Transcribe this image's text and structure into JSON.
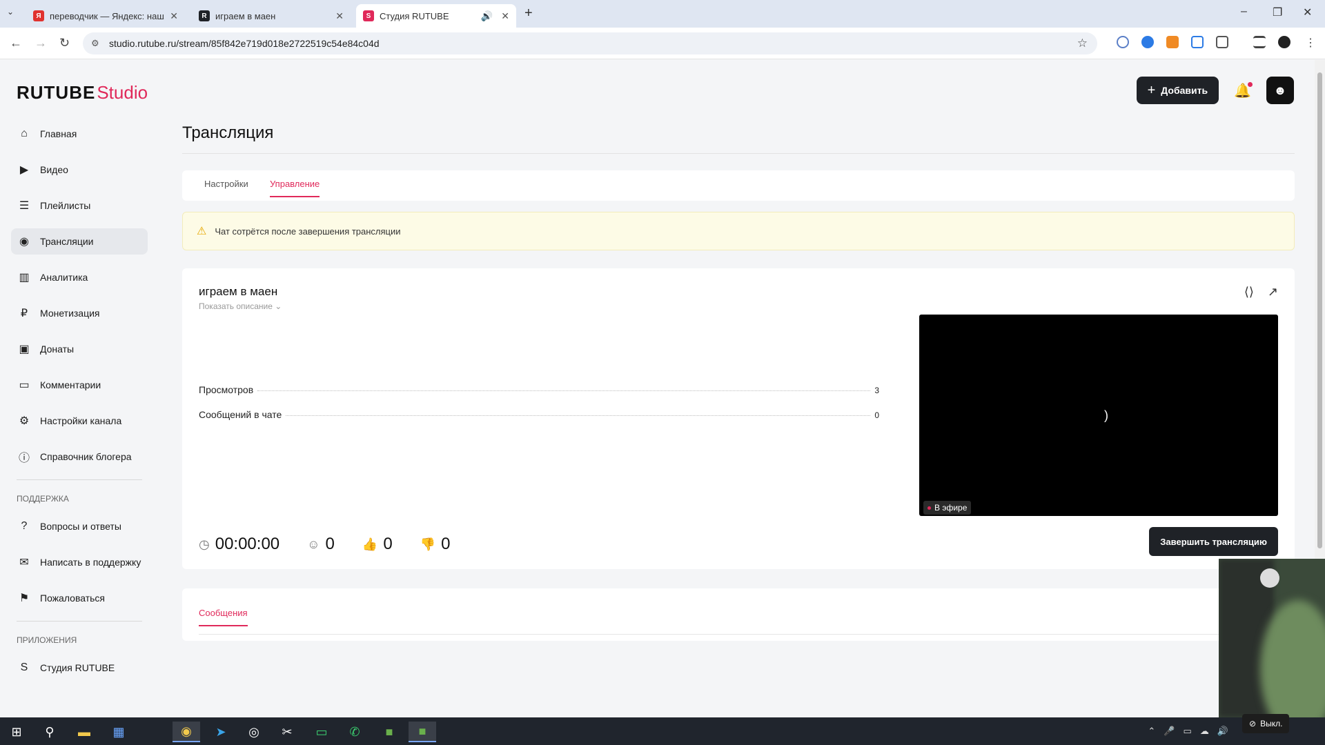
{
  "browser": {
    "tabs": [
      {
        "title": "переводчик — Яндекс: нашлось",
        "icon": "yandex-icon",
        "color": "#e0322f",
        "glyph": "Я"
      },
      {
        "title": "играем в маен",
        "icon": "rutube-icon",
        "color": "#1f2227",
        "glyph": "R"
      },
      {
        "title": "Студия RUTUBE",
        "icon": "rutube-studio-icon",
        "color": "#e0295a",
        "glyph": "S"
      }
    ],
    "url": "studio.rutube.ru/stream/85f842e719d018e2722519c54e84c04d"
  },
  "header": {
    "logo_main": "RUTUBE",
    "logo_sub": "Studio",
    "add_label": "Добавить"
  },
  "sidebar": {
    "items": [
      {
        "label": "Главная",
        "icon": "home-icon",
        "glyph": "⌂"
      },
      {
        "label": "Видео",
        "icon": "video-icon",
        "glyph": "▶"
      },
      {
        "label": "Плейлисты",
        "icon": "playlist-icon",
        "glyph": "☰"
      },
      {
        "label": "Трансляции",
        "icon": "broadcast-icon",
        "glyph": "◉"
      },
      {
        "label": "Аналитика",
        "icon": "analytics-icon",
        "glyph": "▥"
      },
      {
        "label": "Монетизация",
        "icon": "ruble-icon",
        "glyph": "₽"
      },
      {
        "label": "Донаты",
        "icon": "wallet-icon",
        "glyph": "▣"
      },
      {
        "label": "Комментарии",
        "icon": "comment-icon",
        "glyph": "▭"
      },
      {
        "label": "Настройки канала",
        "icon": "gear-icon",
        "glyph": "⚙"
      },
      {
        "label": "Справочник блогера",
        "icon": "info-icon",
        "glyph": "ⓘ"
      }
    ],
    "support_heading": "ПОДДЕРЖКА",
    "support_items": [
      {
        "label": "Вопросы и ответы",
        "icon": "question-icon",
        "glyph": "?"
      },
      {
        "label": "Написать в поддержку",
        "icon": "mail-icon",
        "glyph": "✉"
      },
      {
        "label": "Пожаловаться",
        "icon": "flag-icon",
        "glyph": "⚑"
      }
    ],
    "apps_heading": "ПРИЛОЖЕНИЯ",
    "apps_items": [
      {
        "label": "Студия RUTUBE",
        "icon": "studio-app-icon",
        "glyph": "S"
      }
    ]
  },
  "main": {
    "page_title": "Трансляция",
    "tabs": [
      "Настройки",
      "Управление"
    ],
    "active_tab": "Управление",
    "warning": "Чат сотрётся после завершения трансляции",
    "stream": {
      "title": "играем в маен",
      "show_description": "Показать описание",
      "stats": [
        {
          "label": "Просмотров",
          "value": "3"
        },
        {
          "label": "Сообщений в чате",
          "value": "0"
        }
      ],
      "live_badge": "В эфире",
      "timer": "00:00:00",
      "viewers": "0",
      "likes": "0",
      "dislikes": "0",
      "end_label": "Завершить трансляцию"
    },
    "messages_tab": "Сообщения"
  },
  "overlay": {
    "cam_off": "Выкл."
  },
  "colors": {
    "accent": "#e0295a",
    "dark_button": "#1f2227",
    "warning_bg": "#fdfbe6"
  }
}
